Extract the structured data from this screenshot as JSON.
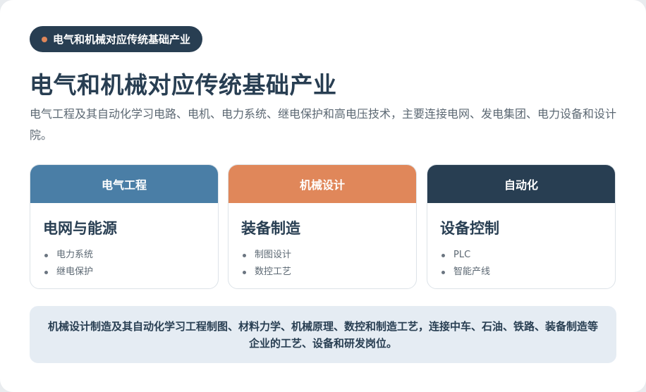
{
  "header": {
    "badge_label": "电气和机械对应传统基础产业",
    "title": "电气和机械对应传统基础产业",
    "description": "电气工程及其自动化学习电路、电机、电力系统、继电保护和高电压技术，主要连接电网、发电集团、电力设备和设计院。"
  },
  "columns": [
    {
      "header": "电气工程",
      "header_color": "#4a7ea6",
      "title": "电网与能源",
      "items": [
        "电力系统",
        "继电保护"
      ]
    },
    {
      "header": "机械设计",
      "header_color": "#e0875a",
      "title": "装备制造",
      "items": [
        "制图设计",
        "数控工艺"
      ]
    },
    {
      "header": "自动化",
      "header_color": "#283e52",
      "title": "设备控制",
      "items": [
        "PLC",
        "智能产线"
      ]
    }
  ],
  "footer": {
    "text": "机械设计制造及其自动化学习工程制图、材料力学、机械原理、数控和制造工艺，连接中车、石油、铁路、装备制造等企业的工艺、设备和研发岗位。"
  },
  "colors": {
    "accent_dark": "#283e52",
    "accent_orange": "#e0875a",
    "accent_blue": "#4a7ea6",
    "footer_bg": "#e5ecf3"
  }
}
